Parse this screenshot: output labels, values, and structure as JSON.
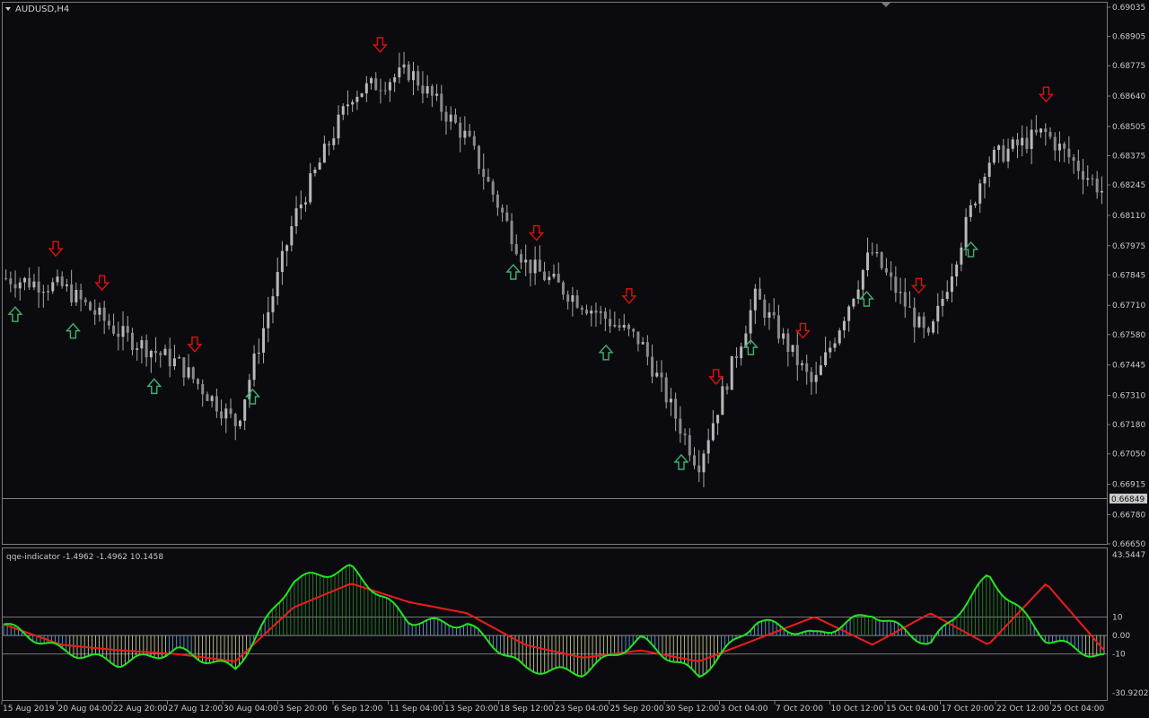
{
  "main_chart": {
    "title": "AUDUSD,H4",
    "current_price": "0.66849",
    "price_ticks": [
      "0.69035",
      "0.68905",
      "0.68775",
      "0.68640",
      "0.68505",
      "0.68375",
      "0.68245",
      "0.68110",
      "0.67975",
      "0.67845",
      "0.67710",
      "0.67580",
      "0.67445",
      "0.67310",
      "0.67180",
      "0.67050",
      "0.66915",
      "0.66780",
      "0.66650"
    ],
    "up_arrow_color": "#3cb371",
    "down_arrow_color": "#e01010",
    "candle_color": "#a8a8a8"
  },
  "indicator": {
    "label": "qqe-indicator -1.4962 -1.4962 10.1458",
    "ticks": [
      "43.5447",
      "10",
      "0.00",
      "-10",
      "-30.9202"
    ],
    "fast_color": "#22e322",
    "slow_color": "#ee1c1c"
  },
  "time_axis": [
    "15 Aug 2019",
    "20 Aug 04:00",
    "22 Aug 20:00",
    "27 Aug 12:00",
    "30 Aug 04:00",
    "3 Sep 20:00",
    "6 Sep 12:00",
    "11 Sep 04:00",
    "13 Sep 20:00",
    "18 Sep 12:00",
    "23 Sep 04:00",
    "25 Sep 20:00",
    "30 Sep 12:00",
    "3 Oct 04:00",
    "7 Oct 20:00",
    "10 Oct 12:00",
    "15 Oct 04:00",
    "17 Oct 20:00",
    "22 Oct 12:00",
    "25 Oct 04:00"
  ],
  "chart_data": {
    "type": "line",
    "symbol": "AUDUSD",
    "timeframe": "H4",
    "price_series": {
      "name": "AUDUSD",
      "x": [
        "15 Aug 2019",
        "20 Aug 04:00",
        "22 Aug 20:00",
        "27 Aug 12:00",
        "30 Aug 04:00",
        "3 Sep 20:00",
        "6 Sep 12:00",
        "11 Sep 04:00",
        "13 Sep 20:00",
        "18 Sep 12:00",
        "23 Sep 04:00",
        "25 Sep 20:00",
        "30 Sep 12:00",
        "3 Oct 04:00",
        "7 Oct 20:00",
        "10 Oct 12:00",
        "15 Oct 04:00",
        "17 Oct 20:00",
        "22 Oct 12:00",
        "25 Oct 04:00"
      ],
      "y": [
        0.6783,
        0.6779,
        0.6758,
        0.6745,
        0.6718,
        0.681,
        0.6865,
        0.6875,
        0.6845,
        0.679,
        0.6772,
        0.6755,
        0.67,
        0.6775,
        0.6735,
        0.6795,
        0.6755,
        0.6835,
        0.6848,
        0.6822
      ]
    },
    "ylim": [
      0.6665,
      0.69035
    ],
    "indicator_series": [
      {
        "name": "fast",
        "x": [
          "15 Aug 2019",
          "20 Aug 04:00",
          "22 Aug 20:00",
          "27 Aug 12:00",
          "30 Aug 04:00",
          "3 Sep 20:00",
          "6 Sep 12:00",
          "11 Sep 04:00",
          "13 Sep 20:00",
          "18 Sep 12:00",
          "23 Sep 04:00",
          "25 Sep 20:00",
          "30 Sep 12:00",
          "3 Oct 04:00",
          "7 Oct 20:00",
          "10 Oct 12:00",
          "15 Oct 04:00",
          "17 Oct 20:00",
          "22 Oct 12:00",
          "25 Oct 04:00"
        ],
        "y": [
          6,
          -8,
          -15,
          -8,
          -18,
          30,
          36,
          8,
          6,
          -18,
          -20,
          -2,
          -22,
          8,
          0,
          12,
          -5,
          32,
          -2,
          -12
        ]
      },
      {
        "name": "slow",
        "x": [
          "15 Aug 2019",
          "20 Aug 04:00",
          "22 Aug 20:00",
          "27 Aug 12:00",
          "30 Aug 04:00",
          "3 Sep 20:00",
          "6 Sep 12:00",
          "11 Sep 04:00",
          "13 Sep 20:00",
          "18 Sep 12:00",
          "23 Sep 04:00",
          "25 Sep 20:00",
          "30 Sep 12:00",
          "3 Oct 04:00",
          "7 Oct 20:00",
          "10 Oct 12:00",
          "15 Oct 04:00",
          "17 Oct 20:00",
          "22 Oct 12:00",
          "25 Oct 04:00"
        ],
        "y": [
          6,
          -5,
          -8,
          -10,
          -14,
          15,
          28,
          18,
          12,
          -5,
          -12,
          -8,
          -14,
          -2,
          10,
          -5,
          12,
          -5,
          28,
          -8
        ]
      }
    ],
    "indicator_ylim": [
      -30.9202,
      43.5447
    ],
    "indicator_levels": [
      10,
      0,
      -10
    ]
  }
}
